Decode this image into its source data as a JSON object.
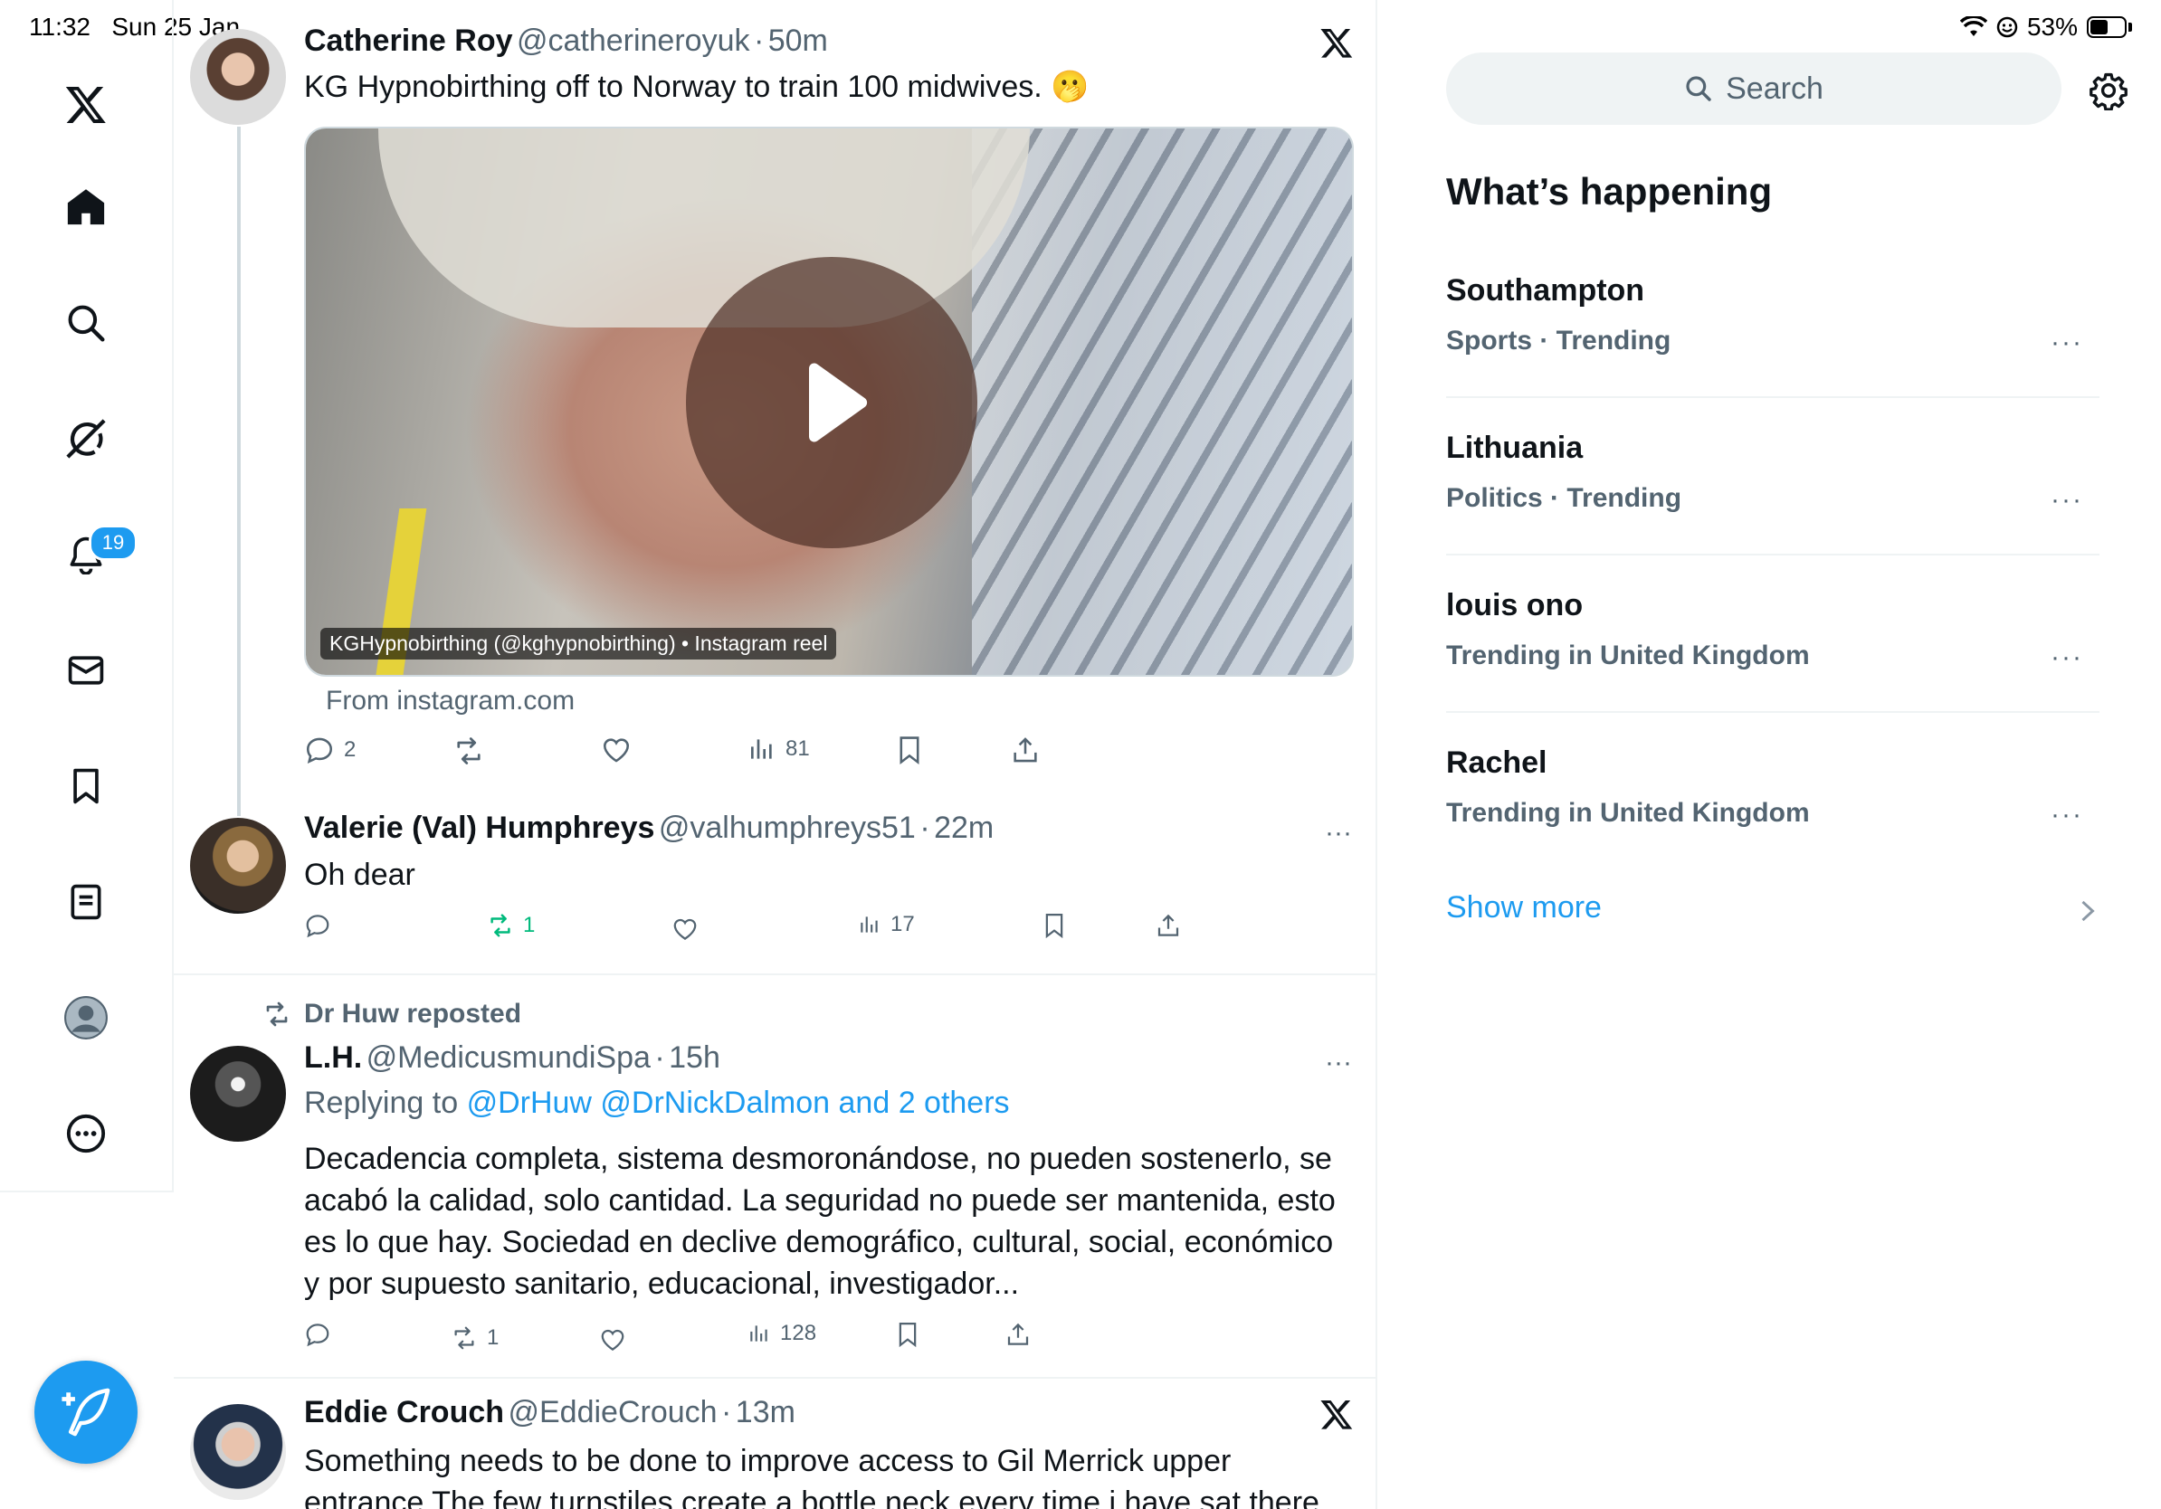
{
  "status_bar": {
    "time": "11:32",
    "date": "Sun 25 Jan",
    "battery": "53%",
    "battery_level": 0.53
  },
  "nav": {
    "items": [
      {
        "icon": "x-logo-icon"
      },
      {
        "icon": "home-icon"
      },
      {
        "icon": "search-icon"
      },
      {
        "icon": "grok-icon"
      },
      {
        "icon": "notifications-icon",
        "badge": "19"
      },
      {
        "icon": "messages-icon"
      },
      {
        "icon": "bookmarks-icon"
      },
      {
        "icon": "lists-icon"
      },
      {
        "icon": "profile-icon"
      },
      {
        "icon": "more-icon"
      }
    ],
    "compose_icon": "compose-icon",
    "accent": "#1d9bf0"
  },
  "feed": {
    "tweet1": {
      "name": "Catherine Roy",
      "handle": "@catherineroyuk",
      "sep": "·",
      "time": "50m",
      "text": "KG Hypnobirthing off to Norway to train 100 midwives. 🫢",
      "media_label": "KGHypnobirthing (@kghypnobirthing) • Instagram reel",
      "source": "From instagram.com",
      "replies": "2",
      "views": "81"
    },
    "tweet2": {
      "name": "Valerie (Val) Humphreys",
      "handle": "@valhumphreys51",
      "sep": "·",
      "time": "22m",
      "text": "Oh dear",
      "reposts": "1",
      "views": "17"
    },
    "tweet3": {
      "repost_label": "Dr Huw reposted",
      "name": "L.H.",
      "handle": "@MedicusmundiSpa",
      "sep": "·",
      "time": "15h",
      "replying_prefix": "Replying to",
      "replying_targets": "@DrHuw @DrNickDalmon and 2 others",
      "text_lines": [
        "Decadencia completa, sistema desmoronándose, no pueden sostenerlo, se",
        "acabó la calidad, solo cantidad. La seguridad no puede ser mantenida, esto",
        "es lo que hay. Sociedad en declive demográfico, cultural, social, económico",
        "y por supuesto sanitario, educacional, investigador..."
      ],
      "reposts": "1",
      "views": "128"
    },
    "tweet4": {
      "name": "Eddie Crouch",
      "handle": "@EddieCrouch",
      "sep": "·",
      "time": "13m",
      "text_lines": [
        "Something needs to be done to improve access to Gil Merrick upper",
        "entrance The few turnstiles create a bottle neck every time i have sat there"
      ]
    }
  },
  "sidebar": {
    "search_placeholder": "Search",
    "section_title": "What’s happening",
    "trends": [
      {
        "title": "Southampton",
        "context": "Sports · Trending"
      },
      {
        "title": "Lithuania",
        "context": "Politics · Trending"
      },
      {
        "title": "louis ono",
        "context": "Trending in United Kingdom"
      },
      {
        "title": "Rachel",
        "context": "Trending in United Kingdom"
      }
    ],
    "show_more": "Show more",
    "more_dots": "···"
  },
  "colors": {
    "text_primary": "#0f1419",
    "text_secondary": "#536471",
    "link": "#1d9bf0",
    "repost_active": "#00ba7c",
    "border": "#eff3f4"
  }
}
